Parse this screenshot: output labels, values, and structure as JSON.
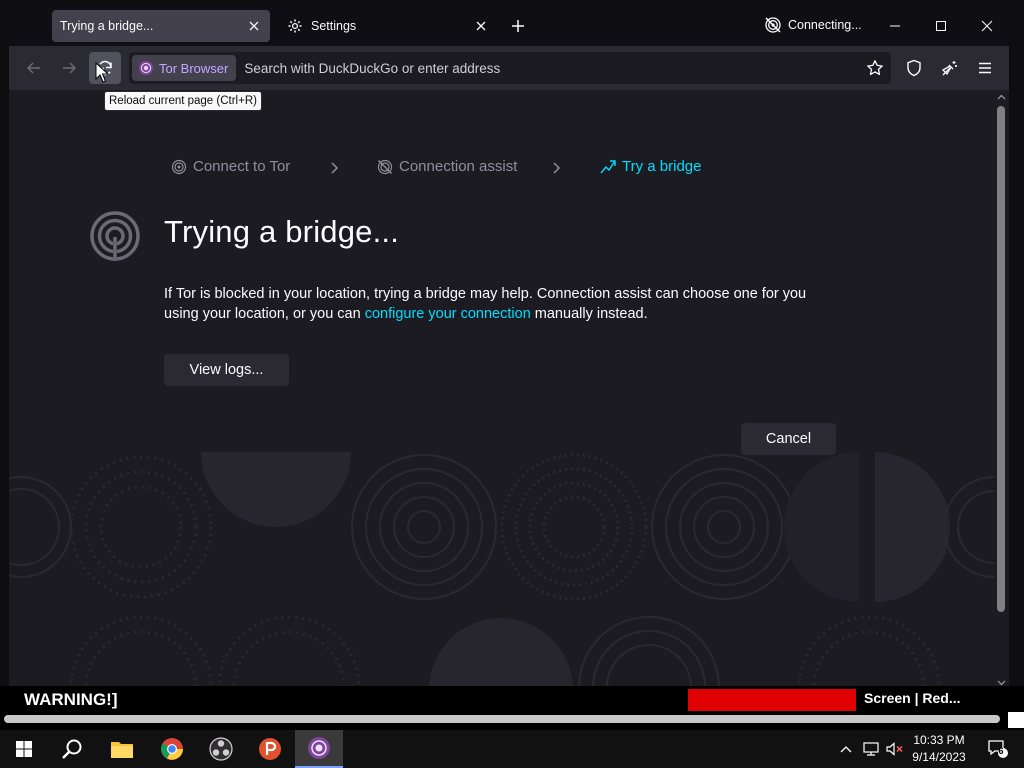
{
  "browser": {
    "tabs": [
      {
        "label": "Trying a bridge..."
      },
      {
        "label": "Settings"
      }
    ],
    "status": "Connecting...",
    "url_badge": "Tor Browser",
    "url_placeholder": "Search with DuckDuckGo or enter address",
    "tooltip": "Reload current page (Ctrl+R)"
  },
  "page": {
    "steps": [
      {
        "label": "Connect to Tor"
      },
      {
        "label": "Connection assist"
      },
      {
        "label": "Try a bridge"
      }
    ],
    "heading": "Trying a bridge...",
    "desc_pre": "If Tor is blocked in your location, trying a bridge may help. Connection assist can choose one for you using your location, or you can ",
    "desc_link": "configure your connection",
    "desc_post": " manually instead.",
    "view_logs": "View logs...",
    "cancel": "Cancel"
  },
  "overlay": {
    "warning": "WARNING!]",
    "screen_text": "Screen | Red..."
  },
  "taskbar": {
    "time": "10:33 PM",
    "date": "9/14/2023",
    "notification_count": "6"
  },
  "colors": {
    "accent": "#00ddff",
    "tor_purple": "#c4a6ff",
    "warning_red": "#e00000"
  }
}
